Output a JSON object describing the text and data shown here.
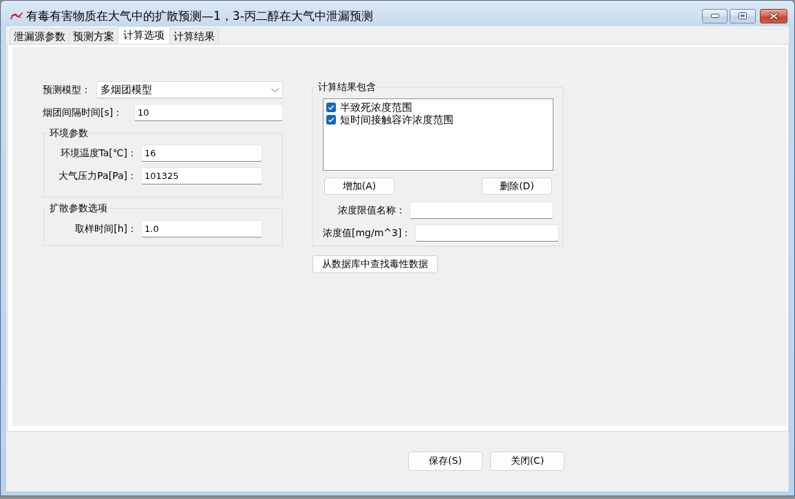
{
  "window": {
    "title": "有毒有害物质在大气中的扩散预测—1，3-丙二醇在大气中泄漏预测"
  },
  "tabs": [
    {
      "label": "泄漏源参数",
      "selected": false
    },
    {
      "label": "预测方案",
      "selected": false
    },
    {
      "label": "计算选项",
      "selected": true
    },
    {
      "label": "计算结果",
      "selected": false
    }
  ],
  "form": {
    "fields": [
      {
        "kind": "dropdown",
        "label": "预测模型：",
        "value": "多烟团模型"
      },
      {
        "kind": "text",
        "label": "烟团间隔时间[s]：",
        "value": "10"
      }
    ]
  },
  "environment_params": {
    "title": "环境参数",
    "fields": [
      {
        "label": "环境温度Ta[℃]：",
        "value": "16"
      },
      {
        "label": "大气压力Pa[Pa]：",
        "value": "101325"
      }
    ]
  },
  "diffusion_params": {
    "title": "扩散参数选项",
    "fields": [
      {
        "label": "取样时间[h]：",
        "value": "1.0"
      }
    ]
  },
  "results_include": {
    "title": "计算结果包含",
    "items": [
      {
        "label": "半致死浓度范围",
        "checked": true
      },
      {
        "label": "短时间接触容许浓度范围",
        "checked": true
      }
    ],
    "buttons": [
      "增加(A)",
      "删除(D)"
    ],
    "fields": [
      {
        "label": "浓度限值名称："
      },
      {
        "label": "浓度值[mg/m^3]："
      }
    ]
  },
  "lookup_button": "从数据库中查找毒性数据",
  "footer_buttons": [
    "保存(S)",
    "关闭(C)"
  ]
}
